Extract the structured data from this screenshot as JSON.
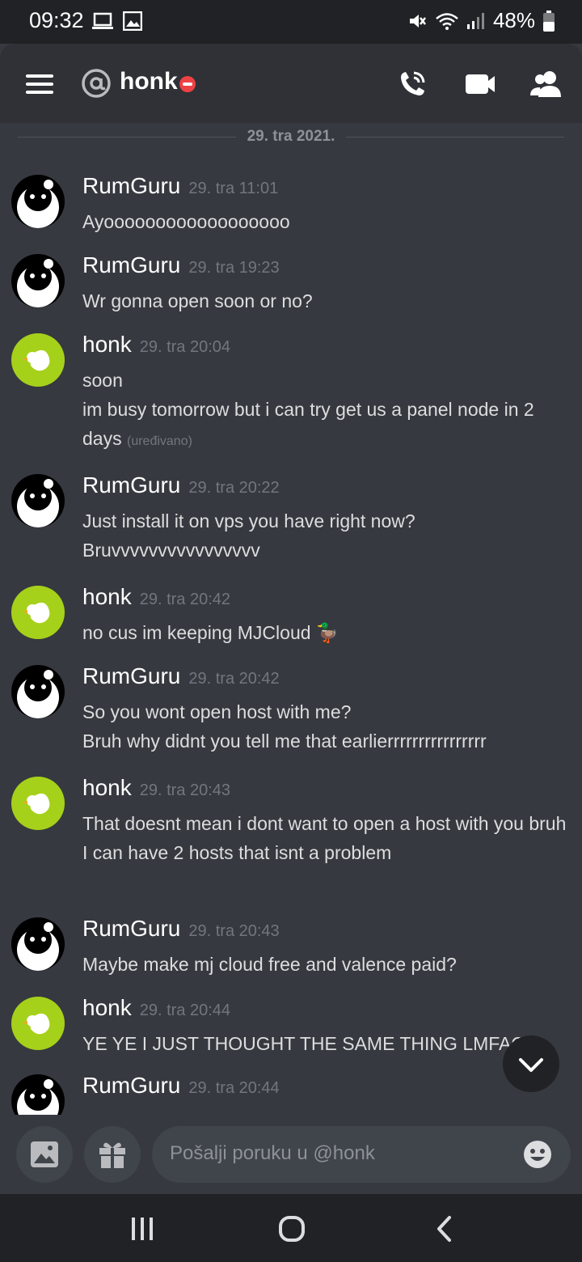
{
  "status_bar": {
    "time": "09:32",
    "battery": "48%"
  },
  "header": {
    "channel_name": "honk",
    "at_symbol": "@"
  },
  "date_divider": "29. tra 2021.",
  "messages": [
    {
      "author": "RumGuru",
      "timestamp": "29. tra 11:01",
      "lines": [
        "Ayoooooooooooooooooo"
      ]
    },
    {
      "author": "RumGuru",
      "timestamp": "29. tra 19:23",
      "lines": [
        "Wr gonna open soon or no?"
      ]
    },
    {
      "author": "honk",
      "timestamp": "29. tra 20:04",
      "lines": [
        "soon",
        "im busy tomorrow but i can try get us a panel node in 2 days"
      ],
      "edited_label": "(uređivano)"
    },
    {
      "author": "RumGuru",
      "timestamp": "29. tra 20:22",
      "lines": [
        "Just install it on vps you have right now?",
        "Bruvvvvvvvvvvvvvvvv"
      ]
    },
    {
      "author": "honk",
      "timestamp": "29. tra 20:42",
      "lines": [
        "no cus im keeping MJCloud"
      ],
      "emoji": "🦆"
    },
    {
      "author": "RumGuru",
      "timestamp": "29. tra 20:42",
      "lines": [
        "So you wont open host with me?",
        "Bruh why didnt you tell me that earlierrrrrrrrrrrrrrrr"
      ]
    },
    {
      "author": "honk",
      "timestamp": "29. tra 20:43",
      "lines": [
        "That doesnt mean i dont want to open a host with you bruh",
        "I can have 2 hosts that isnt a problem"
      ]
    },
    {
      "author": "RumGuru",
      "timestamp": "29. tra 20:43",
      "lines": [
        "Maybe make mj cloud free and valence paid?"
      ]
    },
    {
      "author": "honk",
      "timestamp": "29. tra 20:44",
      "lines": [
        "YE YE I JUST THOUGHT THE SAME THING LMFAO"
      ]
    },
    {
      "author": "RumGuru",
      "timestamp": "29. tra 20:44",
      "lines": [
        ""
      ]
    }
  ],
  "input": {
    "placeholder": "Pošalji poruku u @honk"
  },
  "colors": {
    "background": "#36393f",
    "header": "#2f3136",
    "status_bar": "#202225",
    "honk_avatar": "#a6d11a",
    "dnd": "#ed4245"
  },
  "icons": [
    "hamburger-icon",
    "at-icon",
    "phone-call-icon",
    "video-icon",
    "members-icon",
    "image-icon",
    "gift-icon",
    "emoji-icon",
    "chevron-down-icon"
  ]
}
